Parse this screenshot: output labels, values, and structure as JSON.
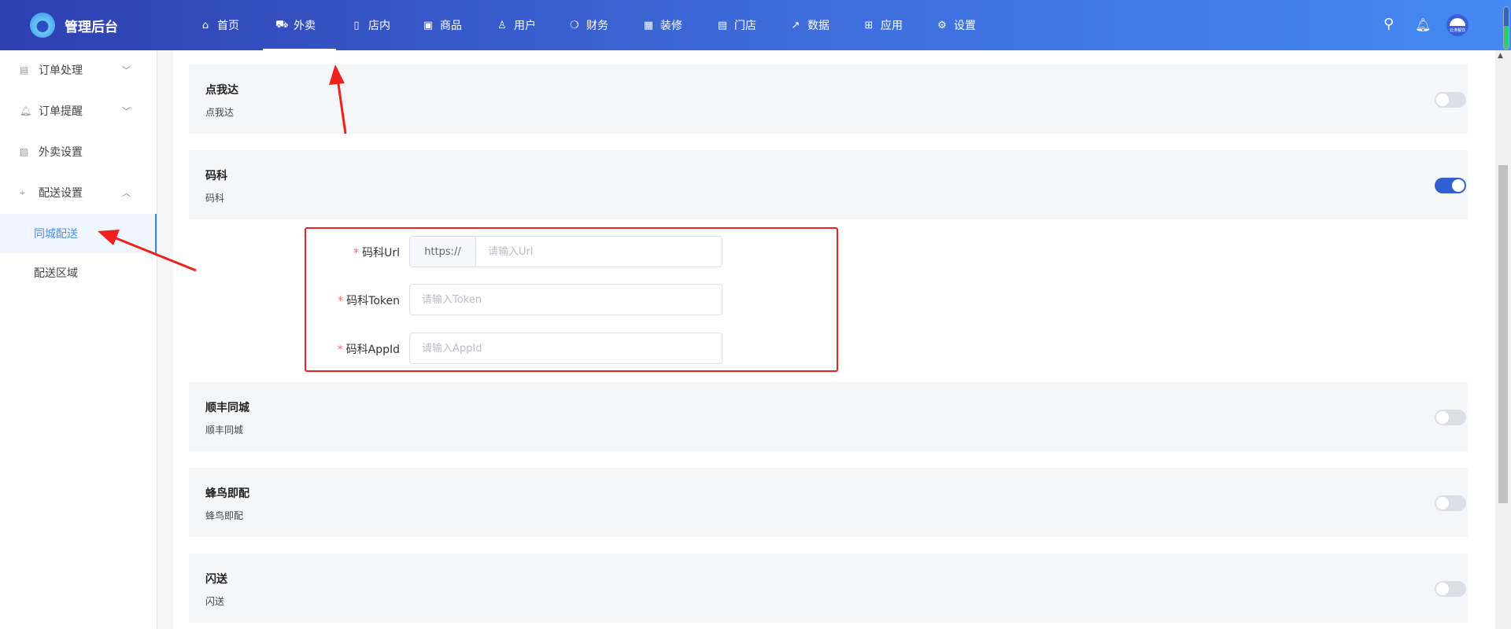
{
  "header": {
    "title": "管理后台",
    "nav": [
      {
        "label": "首页",
        "icon": "home-icon"
      },
      {
        "label": "外卖",
        "icon": "takeout-icon",
        "active": true
      },
      {
        "label": "店内",
        "icon": "dine-in-icon"
      },
      {
        "label": "商品",
        "icon": "goods-icon"
      },
      {
        "label": "用户",
        "icon": "user-icon"
      },
      {
        "label": "财务",
        "icon": "finance-icon"
      },
      {
        "label": "装修",
        "icon": "decoration-icon"
      },
      {
        "label": "门店",
        "icon": "store-icon"
      },
      {
        "label": "数据",
        "icon": "data-icon"
      },
      {
        "label": "应用",
        "icon": "apps-icon"
      },
      {
        "label": "设置",
        "icon": "settings-icon"
      }
    ],
    "avatar_text": "云涛餐饮"
  },
  "sidebar": {
    "items": [
      {
        "label": "订单处理"
      },
      {
        "label": "订单提醒"
      },
      {
        "label": "外卖设置"
      },
      {
        "label": "配送设置"
      },
      {
        "label": "同城配送",
        "active": true
      },
      {
        "label": "配送区域"
      }
    ]
  },
  "cards": [
    {
      "title": "点我达",
      "subtitle": "点我达",
      "enabled": false
    },
    {
      "title": "码科",
      "subtitle": "码科",
      "enabled": true
    },
    {
      "title": "顺丰同城",
      "subtitle": "顺丰同城",
      "enabled": false
    },
    {
      "title": "蜂鸟即配",
      "subtitle": "蜂鸟即配",
      "enabled": false
    },
    {
      "title": "闪送",
      "subtitle": "闪送",
      "enabled": false
    }
  ],
  "form": {
    "url": {
      "label": "码科Url",
      "prefix": "https://",
      "placeholder": "请输入Url",
      "value": ""
    },
    "token": {
      "label": "码科Token",
      "placeholder": "请输入Token",
      "value": ""
    },
    "appid": {
      "label": "码科AppId",
      "placeholder": "请输入AppId",
      "value": ""
    },
    "required_mark": "*"
  },
  "colors": {
    "accent": "#2f5fd0",
    "annotation": "#f0201c",
    "active_text": "#4b8ef0"
  }
}
